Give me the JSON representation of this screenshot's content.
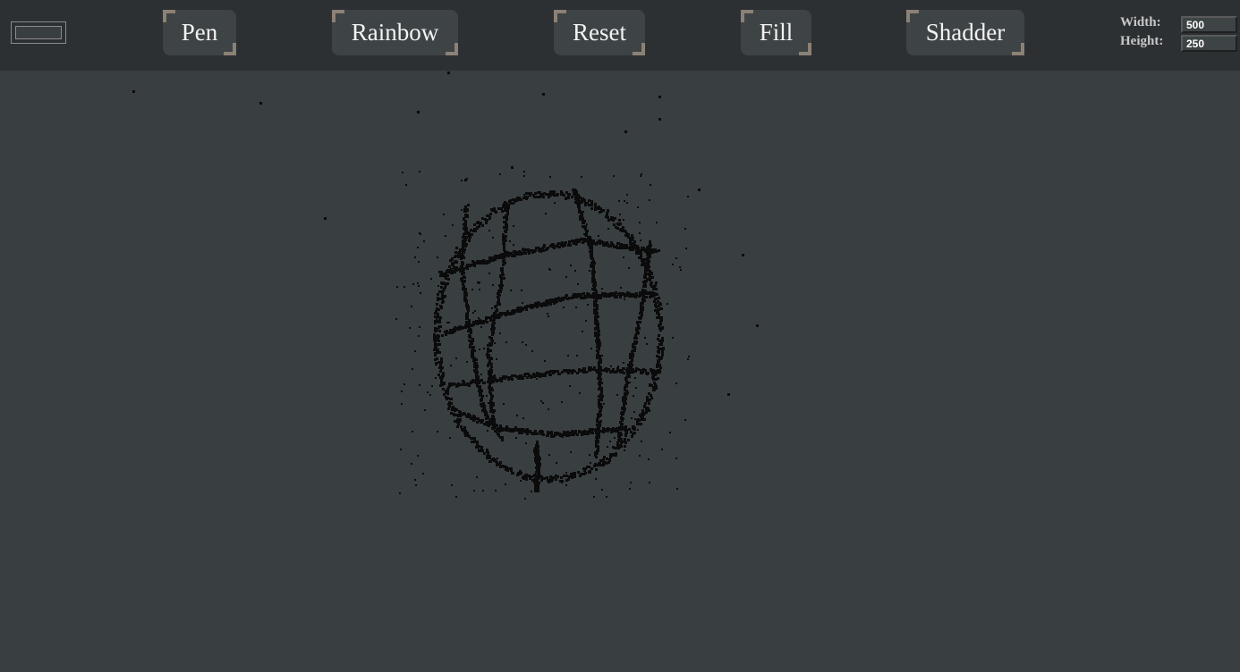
{
  "toolbar": {
    "color_swatch": {
      "value": "#393e41"
    },
    "buttons": [
      {
        "label": "Pen"
      },
      {
        "label": "Rainbow"
      },
      {
        "label": "Reset"
      },
      {
        "label": "Fill"
      },
      {
        "label": "Shadder"
      }
    ],
    "width": {
      "label": "Width:",
      "value": "500"
    },
    "height": {
      "label": "Height:",
      "value": "250"
    }
  },
  "colors": {
    "toolbar_bg": "#2c3033",
    "canvas_bg": "#393e41",
    "button_bg": "#3e4346",
    "button_corner": "#8b8175",
    "ink": "#0b0b0b"
  }
}
